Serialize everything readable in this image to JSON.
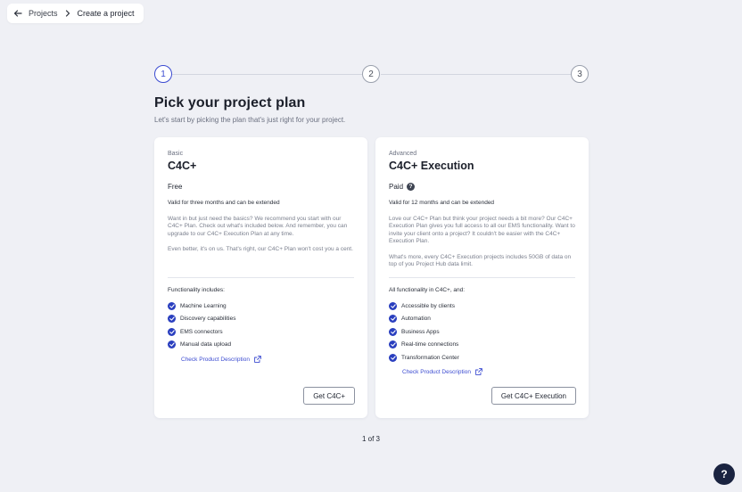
{
  "breadcrumb": {
    "back_icon": "arrow-left-icon",
    "projects": "Projects",
    "separator_icon": "chevron-right-icon",
    "current": "Create a project"
  },
  "stepper": {
    "steps": [
      "1",
      "2",
      "3"
    ],
    "active_step": 1
  },
  "page": {
    "title": "Pick your project plan",
    "subtitle": "Let's start by picking the plan that's just right for your project."
  },
  "plans": [
    {
      "tier": "Basic",
      "name": "C4C+",
      "price": "Free",
      "validity": "Valid for three months and can be extended",
      "desc1": "Want in but just need the basics? We recommend you start with our C4C+ Plan. Check out what's included below. And remember, you can upgrade to our C4C+ Execution Plan at any time.",
      "desc2": "Even better, it's on us. That's right, our C4C+ Plan won't cost you a cent.",
      "features_title": "Functionality includes:",
      "features": [
        "Machine Learning",
        "Discovery capabilities",
        "EMS connectors",
        "Manual data upload"
      ],
      "link": "Check Product Description",
      "cta": "Get C4C+"
    },
    {
      "tier": "Advanced",
      "name": "C4C+ Execution",
      "price": "Paid",
      "validity": "Valid for 12 months and can be extended",
      "desc1": "Love our C4C+ Plan but think your project needs a bit more? Our C4C+ Execution Plan gives you full access to all our EMS functionality. Want to invite your client onto a project? It couldn't be easier with the C4C+ Execution Plan.",
      "desc2": "What's more, every C4C+ Execution projects includes 50GB of data on top of you Project Hub data limit.",
      "features_title": "All functionality in C4C+, and:",
      "features": [
        "Accessible by clients",
        "Automation",
        "Business Apps",
        "Real-time connections",
        "Transformation Center"
      ],
      "link": "Check Product Description",
      "cta": "Get C4C+ Execution"
    }
  ],
  "pager": "1 of 3",
  "help_fab": "?",
  "colors": {
    "background": "#eff0f5",
    "accent": "#3b4bd1",
    "check": "#2a3fbf",
    "fab": "#1a2340"
  }
}
